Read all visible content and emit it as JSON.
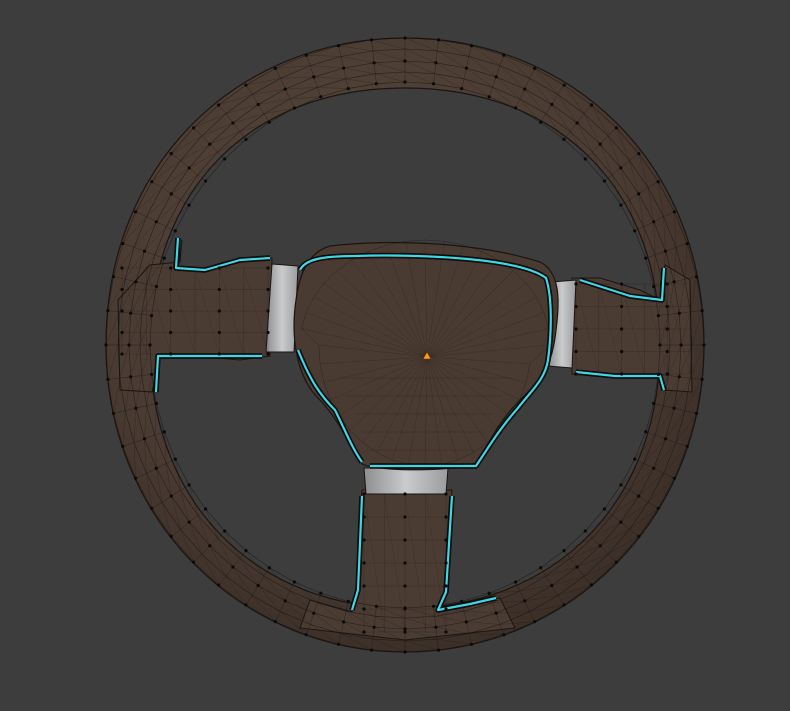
{
  "viewport": {
    "background": "#3d3d3d",
    "mode": "edit-mode-wireframe"
  },
  "model": {
    "object": "steering-wheel-mesh",
    "colors": {
      "face": "#4b3c33",
      "face_light": "#6b5a4f",
      "edge": "#1b1512",
      "vertex": "#0a0a0a",
      "seam_outer": "#0b0b0b",
      "seam_highlight": "#3fd6e6",
      "spoke_gap": "#b9bbbd",
      "origin": "#ff9a1a"
    },
    "parts": [
      "rim",
      "hub",
      "left-spoke",
      "right-spoke",
      "bottom-spoke"
    ]
  }
}
